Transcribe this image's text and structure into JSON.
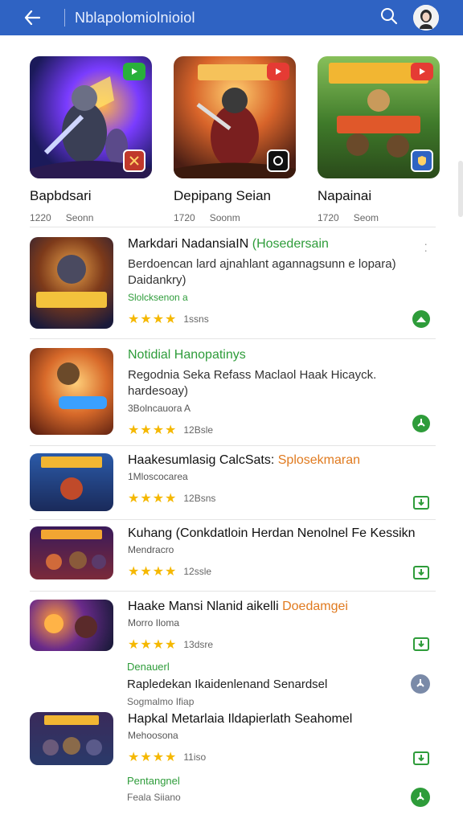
{
  "header": {
    "title": "Nblapolomiolnioiol",
    "colors": {
      "bar": "#2f63c3"
    }
  },
  "featured": [
    {
      "title": "Bapbdsari",
      "meta1": "1220",
      "meta2": "Seonn",
      "play_color": "#29b03a",
      "corner_icon": "swords-badge-icon"
    },
    {
      "title": "Depipang Seian",
      "meta1": "1720",
      "meta2": "Soonm",
      "play_color": "#e53b34",
      "corner_icon": "gear-badge-icon"
    },
    {
      "title": "Napainai",
      "meta1": "1720",
      "meta2": "Seom",
      "play_color": "#e53b34",
      "corner_icon": "shield-badge-icon"
    }
  ],
  "list": [
    {
      "title": "Markdari NadansiaIN",
      "tag": "(Hosedersain",
      "desc1": "Berdoencan lard ajnahlant agannagsunn e lopara)",
      "desc2": "Daidankry)",
      "sub": "Slolcksenon a",
      "stars": "★★★★",
      "count": "1ssns",
      "action_icon": "download-icon"
    },
    {
      "title": "Notidial Hanopatinys",
      "tag": "",
      "desc1": "Regodnia Seka Refass Maclaol Haak Hicayck.",
      "desc2": "hardesoay)",
      "sub": "3Bolncauora A",
      "stars": "★★★★",
      "count": "12Bsle",
      "action_icon": "install-icon"
    },
    {
      "title": "Haakesumlasig CalcSats:",
      "tag": "Splosekmaran",
      "desc1": "",
      "desc2": "",
      "sub": "1Mloscocarea",
      "stars": "★★★★",
      "count": "12Bsns",
      "action_icon": "install-box-icon"
    },
    {
      "title": "Kuhang (Conkdatloin Herdan Nenolnel Fe Kessikn",
      "tag": "",
      "desc1": "",
      "desc2": "",
      "sub": "Mendracro",
      "stars": "★★★★",
      "count": "12ssle",
      "action_icon": "install-box-icon"
    },
    {
      "title": "Haake Mansi Nlanid aikelli",
      "tag": "Doedamgei",
      "desc1": "",
      "desc2": "",
      "sub": "Morro Iloma",
      "stars": "★★★★",
      "count": "13dsre",
      "action_icon": "install-box-icon"
    },
    {
      "title": "Hapkal Metarlaia Ildapierlath Seahomel",
      "tag": "",
      "desc1": "",
      "desc2": "",
      "sub": "Mehoosona",
      "stars": "★★★★",
      "count": "11iso",
      "action_icon": "install-box-icon"
    }
  ],
  "plain_items": [
    {
      "label": "Denauerl",
      "title": "Rapledekan Ikaidenlenand Senardsel",
      "sub": "Sogmalmo Ifiap",
      "action_icon": "install-icon"
    },
    {
      "label": "Pentangnel",
      "title": "",
      "sub": "Feala Siiano",
      "action_icon": "install-icon"
    }
  ]
}
